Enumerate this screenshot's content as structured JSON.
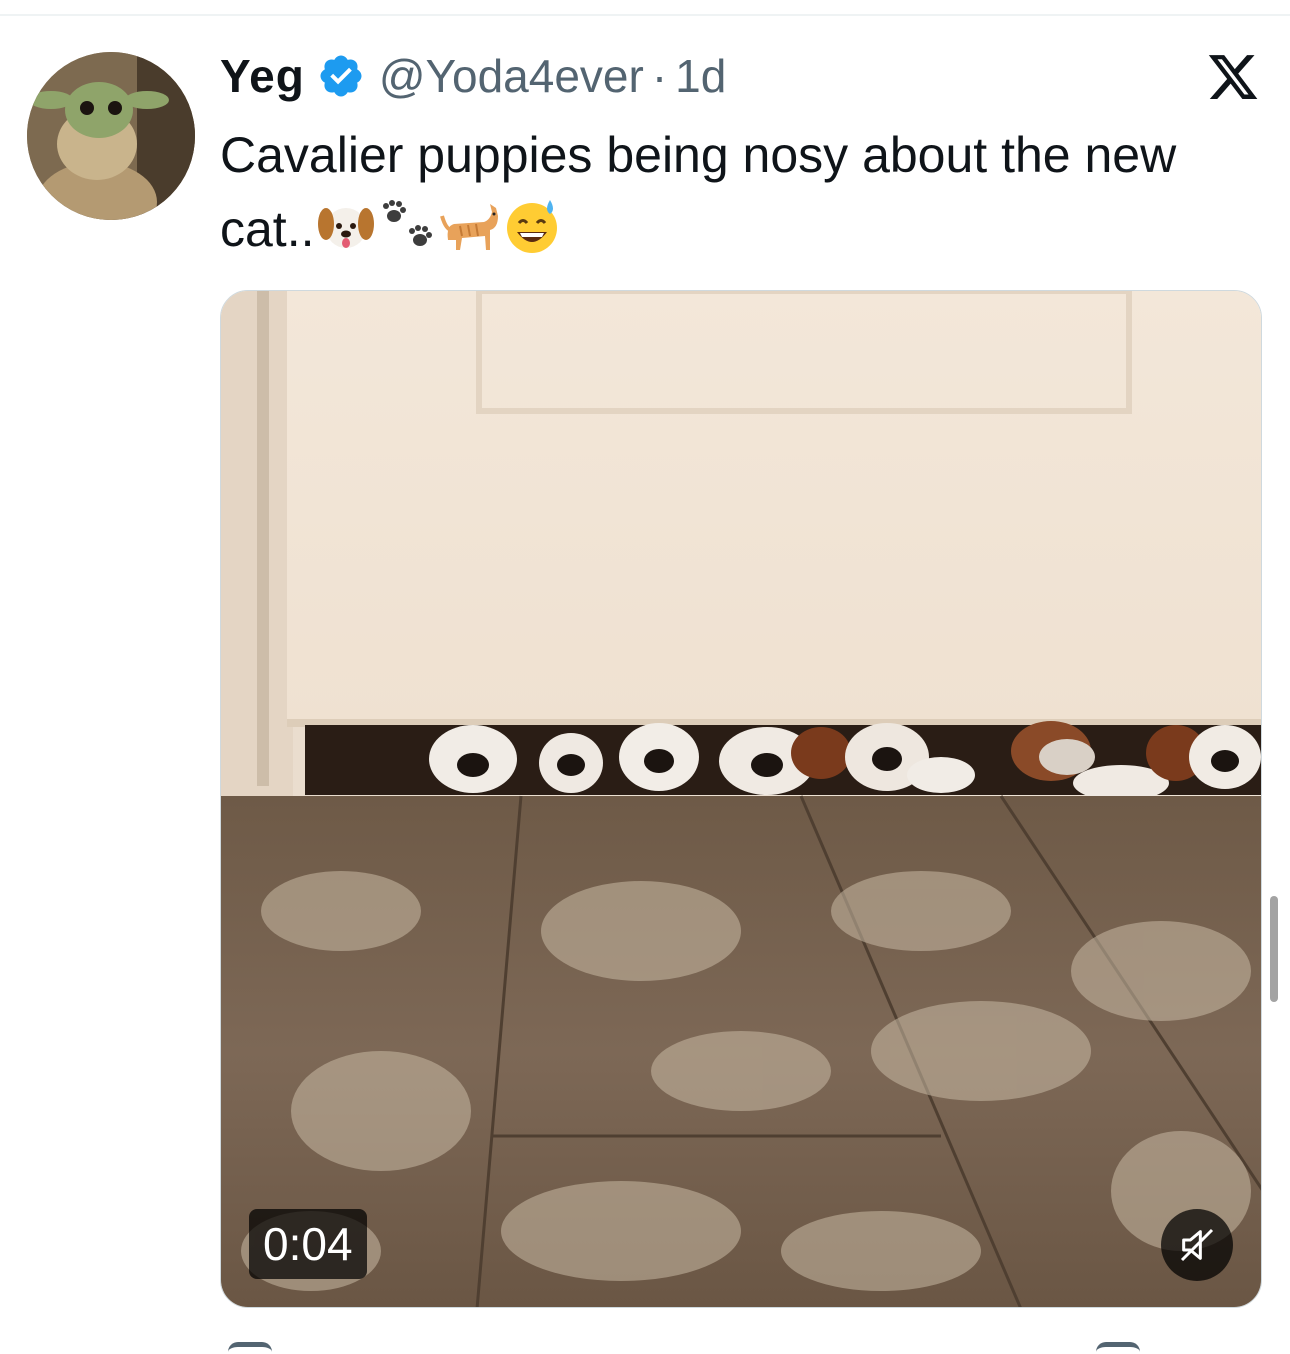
{
  "tweet": {
    "display_name": "Yeg",
    "handle": "@Yoda4ever",
    "separator": "·",
    "time": "1d",
    "text": "Cavalier puppies being nosy about the new cat..",
    "emojis": [
      "dog-face-emoji",
      "paw-prints-emoji",
      "cat-emoji",
      "sweat-smile-emoji"
    ],
    "verified": true
  },
  "video": {
    "duration": "0:04",
    "muted": true
  },
  "colors": {
    "verified_blue": "#1d9bf0",
    "secondary_text": "#536471",
    "primary_text": "#0f1419"
  }
}
